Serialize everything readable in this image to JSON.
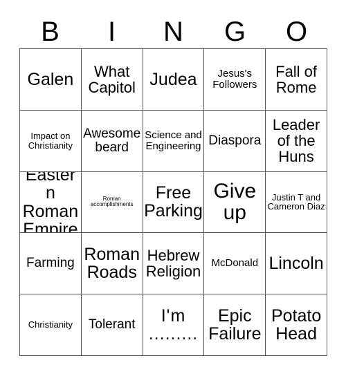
{
  "card": {
    "title_letters": [
      "B",
      "I",
      "N",
      "G",
      "O"
    ],
    "background_color": "#ffffff",
    "border_color": "#555555",
    "text_color": "#000000"
  },
  "grid": {
    "columns": 5,
    "rows": 5,
    "cells": [
      {
        "text": "Galen",
        "size": "xl"
      },
      {
        "text": "What Capitol",
        "size": "lg"
      },
      {
        "text": "Judea",
        "size": "xl"
      },
      {
        "text": "Jesus's Followers",
        "size": "sm"
      },
      {
        "text": "Fall of Rome",
        "size": "lg"
      },
      {
        "text": "Impact on Christianity",
        "size": "xs"
      },
      {
        "text": "Awesome beard",
        "size": "md"
      },
      {
        "text": "Science and Engineering",
        "size": "sm"
      },
      {
        "text": "Diaspora",
        "size": "md"
      },
      {
        "text": "Leader of the Huns",
        "size": "lg"
      },
      {
        "text": "Eastern Roman Empire",
        "size": "xl"
      },
      {
        "text": "Roman accomplishments",
        "size": "xxs"
      },
      {
        "text": "Free Parking",
        "size": "xl"
      },
      {
        "text": "Give up",
        "size": "xxl"
      },
      {
        "text": "Justin T and Cameron Diaz",
        "size": "xs"
      },
      {
        "text": "Farming",
        "size": "md"
      },
      {
        "text": "Roman Roads",
        "size": "xl"
      },
      {
        "text": "Hebrew Religion",
        "size": "lg"
      },
      {
        "text": "McDonald",
        "size": "sm"
      },
      {
        "text": "Lincoln",
        "size": "xl"
      },
      {
        "text": "Christianity",
        "size": "xs"
      },
      {
        "text": "Tolerant",
        "size": "md"
      },
      {
        "text": "I'm .........",
        "size": "xl"
      },
      {
        "text": "Epic Failure",
        "size": "xl"
      },
      {
        "text": "Potato Head",
        "size": "xl"
      }
    ]
  }
}
